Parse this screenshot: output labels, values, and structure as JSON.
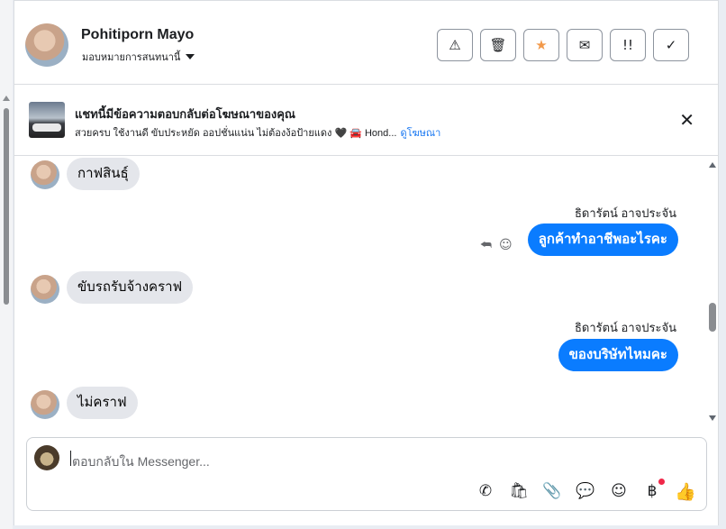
{
  "contact": {
    "name": "Pohitiporn Mayo",
    "assign_label": "มอบหมายการสนทนานี้"
  },
  "header_actions": [
    {
      "icon": "warning-icon",
      "glyph": "⚠"
    },
    {
      "icon": "trash-icon",
      "glyph": "🗑"
    },
    {
      "icon": "star-icon",
      "glyph": "★"
    },
    {
      "icon": "mail-icon",
      "glyph": "✉"
    },
    {
      "icon": "priority-icon",
      "glyph": "!!"
    },
    {
      "icon": "check-icon",
      "glyph": "✓"
    }
  ],
  "ad": {
    "title": "แชทนี้มีข้อความตอบกลับต่อโฆษณาของคุณ",
    "subtitle": "สวยครบ ใช้งานดี ขับประหยัด ออปชั่นแน่น ไม่ต้องง้อป้ายแดง 🖤 🚘 Hond...",
    "link": "ดูโฆษณา",
    "close_glyph": "✕"
  },
  "messages": [
    {
      "direction": "in",
      "text": "กาฟสินธุ์"
    },
    {
      "direction": "out",
      "sender": "ธิดารัตน์ อาจประจัน",
      "text": "ลูกค้าทำอาชีพอะไรคะ"
    },
    {
      "direction": "in",
      "text": "ขับรถรับจ้างคราฟ"
    },
    {
      "direction": "out",
      "sender": "ธิดารัตน์ อาจประจัน",
      "text": "ของบริษัทไหมคะ"
    },
    {
      "direction": "in",
      "text": "ไม่คราฟ"
    }
  ],
  "message_tools": {
    "reply_glyph": "⮪",
    "emoji_glyph": "☺"
  },
  "composer": {
    "placeholder": "ตอบกลับใน Messenger...",
    "tools": [
      {
        "icon": "call-add-icon",
        "glyph": "✆"
      },
      {
        "icon": "bag-icon",
        "glyph": "🛍"
      },
      {
        "icon": "paperclip-icon",
        "glyph": "📎"
      },
      {
        "icon": "chat-bubble-icon",
        "glyph": "💬"
      },
      {
        "icon": "emoji-icon",
        "glyph": "☺"
      },
      {
        "icon": "baht-icon",
        "glyph": "฿"
      },
      {
        "icon": "like-icon",
        "glyph": "👍"
      }
    ]
  },
  "colors": {
    "accent": "#0a7cff",
    "bubble_in": "#e4e6eb",
    "star": "#f2994a",
    "notification": "#f02849"
  }
}
